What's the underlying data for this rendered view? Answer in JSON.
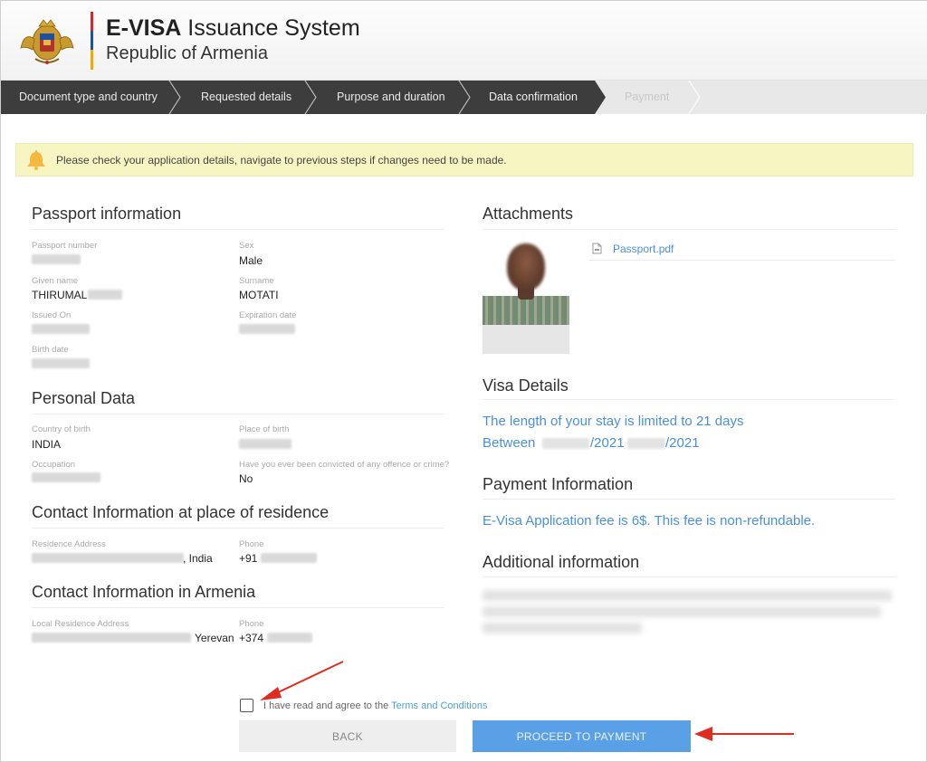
{
  "header": {
    "title_bold": "E-VISA",
    "title_rest": " Issuance System",
    "subtitle": "Republic of Armenia"
  },
  "steps": [
    {
      "label": "Document type and country",
      "state": "done"
    },
    {
      "label": "Requested details",
      "state": "done"
    },
    {
      "label": "Purpose and duration",
      "state": "done"
    },
    {
      "label": "Data confirmation",
      "state": "active"
    },
    {
      "label": "Payment",
      "state": "pending"
    }
  ],
  "notice": {
    "icon": "bell-icon",
    "text": "Please check your application details, navigate to previous steps if changes need to be made."
  },
  "passport": {
    "title": "Passport information",
    "passport_number_label": "Passport number",
    "sex_label": "Sex",
    "sex_value": "Male",
    "given_name_label": "Given name",
    "given_name_value": "THIRUMAL",
    "surname_label": "Surname",
    "surname_value": "MOTATI",
    "issued_on_label": "Issued On",
    "expiration_label": "Expiration date",
    "birth_date_label": "Birth date"
  },
  "personal": {
    "title": "Personal Data",
    "country_birth_label": "Country of birth",
    "country_birth_value": "INDIA",
    "place_birth_label": "Place of birth",
    "occupation_label": "Occupation",
    "convicted_label": "Have you ever been convicted of any offence or crime?",
    "convicted_value": "No"
  },
  "contact_residence": {
    "title": "Contact Information at place of residence",
    "address_label": "Residence Address",
    "address_suffix": ", India",
    "phone_label": "Phone",
    "phone_prefix": "+91"
  },
  "contact_armenia": {
    "title": "Contact Information in Armenia",
    "address_label": "Local Residence Address",
    "address_suffix": "Yerevan",
    "phone_label": "Phone",
    "phone_prefix": "+374"
  },
  "attachments": {
    "title": "Attachments",
    "file_icon": "pdf-file-icon",
    "file_name": "Passport.pdf"
  },
  "visa_details": {
    "title": "Visa Details",
    "stay_text": "The length of your stay is limited to 21 days",
    "between_label": "Between",
    "date_sep": "/2021 -",
    "date_end": "/2021"
  },
  "payment_info": {
    "title": "Payment Information",
    "fee_text": "E-Visa Application fee is 6$. This fee is non-refundable."
  },
  "additional": {
    "title": "Additional information"
  },
  "terms": {
    "text": "I have read and agree to the ",
    "link": "Terms and Conditions"
  },
  "buttons": {
    "back": "BACK",
    "proceed": "PROCEED TO PAYMENT"
  },
  "colors": {
    "step_bar": "#3d3d3d",
    "accent_blue": "#4a90d9",
    "notice_bg": "#f7f6c3",
    "button_blue": "#5aa0e6",
    "annotation_red": "#e02b1f"
  }
}
